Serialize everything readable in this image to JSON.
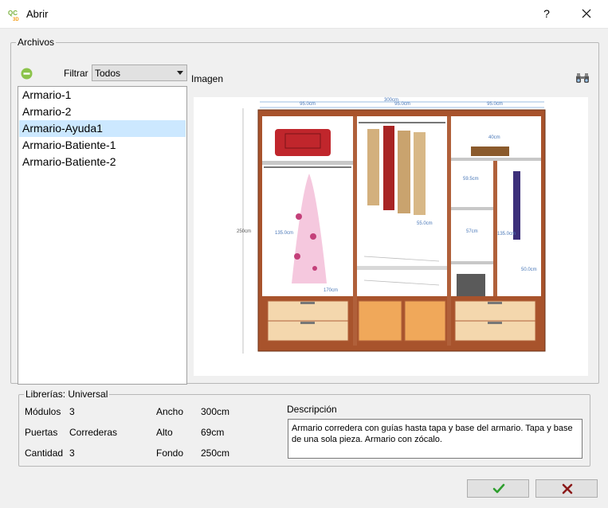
{
  "window": {
    "title": "Abrir",
    "help": "?"
  },
  "files": {
    "legend": "Archivos",
    "filter_label": "Filtrar",
    "filter_value": "Todos",
    "items": [
      "Armario-1",
      "Armario-2",
      "Armario-Ayuda1",
      "Armario-Batiente-1",
      "Armario-Batiente-2"
    ],
    "selected_index": 2
  },
  "preview": {
    "label": "Imagen",
    "dims": {
      "top_total": "300cm",
      "left_width": "95.0cm",
      "mid_width": "95.0cm",
      "right_width": "95.0cm",
      "height": "250cm",
      "shelf_right": "40cm",
      "drawer_left": "170cm",
      "col_mid": "55.0cm",
      "col_right_a": "59.5cm",
      "col_right_b": "57cm",
      "col_right_c": "135.0cm",
      "col_right_d": "50.0cm",
      "col_left": "135.0cm"
    }
  },
  "library": {
    "legend": "Librerías: Universal",
    "modulos_label": "Módulos",
    "modulos_value": "3",
    "puertas_label": "Puertas",
    "puertas_value": "Correderas",
    "cantidad_label": "Cantidad",
    "cantidad_value": "3",
    "ancho_label": "Ancho",
    "ancho_value": "300cm",
    "alto_label": "Alto",
    "alto_value": "69cm",
    "fondo_label": "Fondo",
    "fondo_value": "250cm",
    "descripcion_label": "Descripción",
    "descripcion": "Armario corredera con guías hasta tapa y base del armario. Tapa y base de una sola pieza. Armario con zócalo."
  },
  "colors": {
    "ok": "#2e9e2e",
    "cancel": "#8b1a1a",
    "selection": "#cce8ff",
    "wood": "#a0522d"
  }
}
